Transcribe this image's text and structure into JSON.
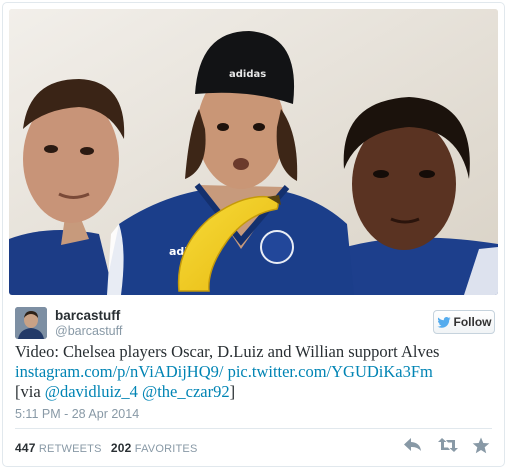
{
  "user": {
    "name": "barcastuff",
    "handle": "@barcastuff"
  },
  "follow": {
    "label": "Follow"
  },
  "tweet": {
    "line1": "Video: Chelsea players Oscar, D.Luiz and Willian support Alves",
    "link1": "instagram.com/p/nViADijHQ9/",
    "link2": "pic.twitter.com/YGUDiKa3Fm",
    "via_prefix": "[via ",
    "mention1": "@davidluiz_4",
    "mention2": "@the_czar92",
    "via_suffix": "]"
  },
  "timestamp": "5:11 PM - 28 Apr 2014",
  "stats": {
    "retweets_count": "447",
    "retweets_label": "RETWEETS",
    "favorites_count": "202",
    "favorites_label": "FAVORITES"
  },
  "icons": {
    "reply": "reply-icon",
    "retweet": "retweet-icon",
    "favorite": "favorite-icon",
    "bird": "twitter-bird-icon"
  },
  "colors": {
    "link": "#0084b4",
    "muted": "#8899a6",
    "bird": "#55acee",
    "banana": "#f2cc1c",
    "kit": "#1a3a7c"
  }
}
